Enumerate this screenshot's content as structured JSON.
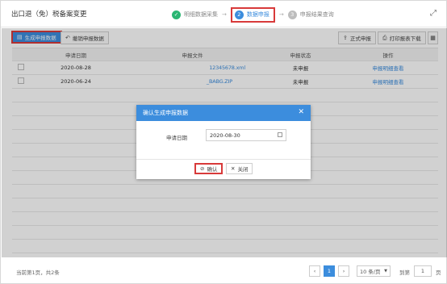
{
  "header": {
    "title": "出口退（免）税备案变更",
    "steps": [
      {
        "num": "✓",
        "label": "明细数据采集"
      },
      {
        "num": "2",
        "label": "数据申报"
      },
      {
        "num": "3",
        "label": "申报结果查询"
      }
    ],
    "expand_icon": "expand-icon"
  },
  "toolbar": {
    "generate_label": "生成申报数据",
    "revoke_label": "撤销申报数据",
    "formal_label": "正式申报",
    "print_label": "打印报表下载"
  },
  "table": {
    "columns": [
      "申请日期",
      "申报文件",
      "申报状态",
      "操作"
    ],
    "rows": [
      {
        "date": "2020-08-28",
        "file": "12345678.xml",
        "status": "未申报",
        "action": "申报明细查看"
      },
      {
        "date": "2020-06-24",
        "file": "_BABG.ZIP",
        "status": "未申报",
        "action": "申报明细查看"
      }
    ]
  },
  "dialog": {
    "title": "确认生成申报数据",
    "date_label": "申请日期",
    "date_value": "2020-08-30",
    "confirm_label": "确认",
    "close_label": "关闭"
  },
  "footer": {
    "summary": "当前第1页，共2条",
    "prev": "‹",
    "current_page": "1",
    "next": "›",
    "page_size": "10 条/页",
    "goto_label": "到第",
    "goto_value": "1",
    "page_unit": "页"
  },
  "colors": {
    "accent": "#3c8ddd",
    "highlight": "#d83a3a",
    "done": "#2bb673"
  }
}
